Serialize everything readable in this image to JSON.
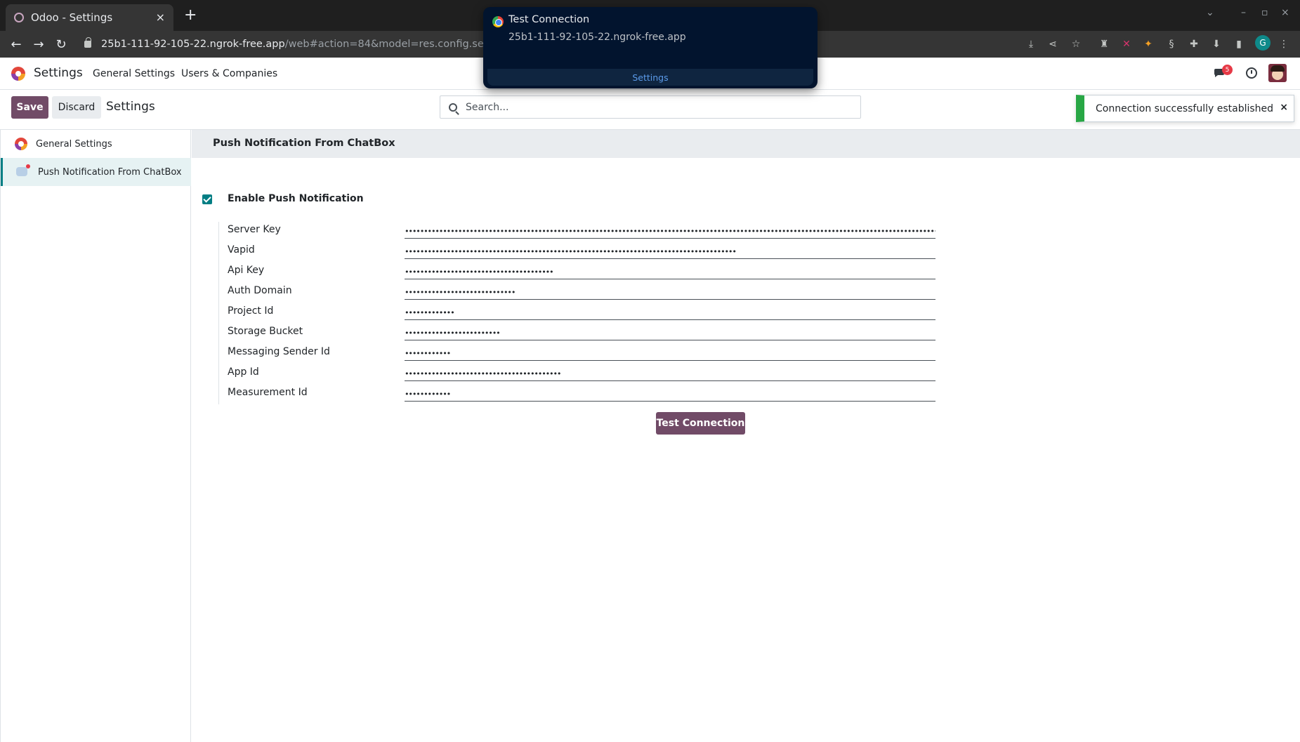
{
  "browser": {
    "tab_title": "Odoo - Settings",
    "tab_close": "×",
    "new_tab": "+",
    "url_host": "25b1-111-92-105-22.ngrok-free.app",
    "url_path": "/web#action=84&model=res.config.settings&view_",
    "profile_letter": "G"
  },
  "notification": {
    "title": "Test Connection",
    "origin": "25b1-111-92-105-22.ngrok-free.app",
    "action": "Settings"
  },
  "navbar": {
    "app_name": "Settings",
    "menu": [
      "General Settings",
      "Users & Companies"
    ],
    "chat_badge": "5"
  },
  "control": {
    "save_label": "Save",
    "discard_label": "Discard",
    "breadcrumb": "Settings",
    "search_placeholder": "Search..."
  },
  "toast": {
    "message": "Connection successfully established",
    "close": "×"
  },
  "sidebar": {
    "items": [
      {
        "label": "General Settings",
        "active": false
      },
      {
        "label": "Push Notification From ChatBox",
        "active": true
      }
    ]
  },
  "section": {
    "title": "Push Notification From ChatBox",
    "enable_label": "Enable Push Notification",
    "enable_checked": true,
    "fields": [
      {
        "label": "Server Key",
        "value": "••••••••••••••••••••••••••••••••••••••••••••••••••••••••••••••••••••••••••••••••••••••••••••••••••••••••••••••••••••••••••••••••••••••••••••••••••••"
      },
      {
        "label": "Vapid",
        "value": "•••••••••••••••••••••••••••••••••••••••••••••••••••••••••••••••••••••••••••••••••••••••"
      },
      {
        "label": "Api Key",
        "value": "•••••••••••••••••••••••••••••••••••••••"
      },
      {
        "label": "Auth Domain",
        "value": "•••••••••••••••••••••••••••••"
      },
      {
        "label": "Project Id",
        "value": "•••••••••••••"
      },
      {
        "label": "Storage Bucket",
        "value": "•••••••••••••••••••••••••"
      },
      {
        "label": "Messaging Sender Id",
        "value": "••••••••••••"
      },
      {
        "label": "App Id",
        "value": "•••••••••••••••••••••••••••••••••••••••••"
      },
      {
        "label": "Measurement Id",
        "value": "••••••••••••"
      }
    ],
    "test_button": "Test Connection"
  },
  "colors": {
    "primary": "#714b67",
    "teal": "#017e84",
    "success": "#28a745"
  }
}
